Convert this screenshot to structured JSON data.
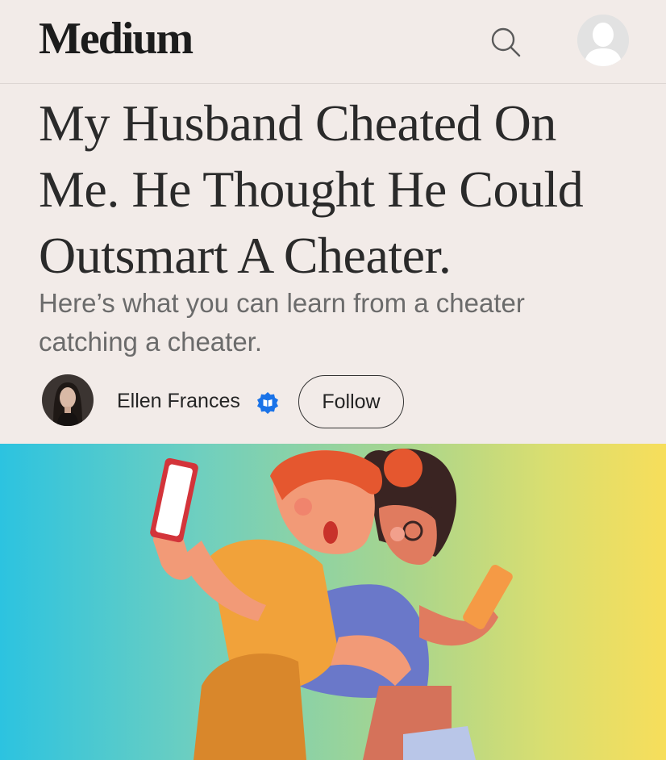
{
  "header": {
    "logo_text": "Medium",
    "search_icon": "search-icon",
    "profile_icon": "user-avatar-icon"
  },
  "article": {
    "title": "My Husband Cheated On Me. He Thought He Could Outsmart A Cheater.",
    "subtitle": "Here’s what you can learn from a cheater catching a cheater.",
    "author": {
      "name": "Ellen Frances",
      "badge_icon": "verified-book-badge-icon",
      "follow_label": "Follow"
    }
  },
  "hero_image": {
    "subject": "illustration-two-people-back-to-back-with-phones",
    "gradient_colors": [
      "#2cc3e0",
      "#a7d58e",
      "#f7de5b"
    ]
  },
  "colors": {
    "background": "#f2ebe8",
    "text": "#242424",
    "subtitle": "#6b6b6b",
    "badge": "#1a73e8"
  }
}
